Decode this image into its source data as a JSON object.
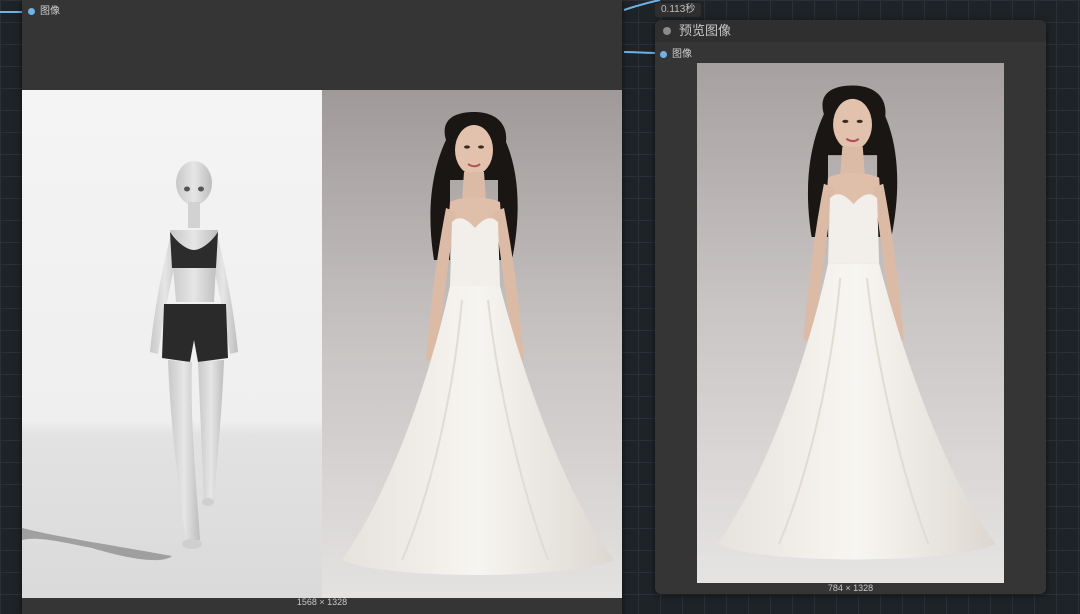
{
  "left_node": {
    "output_label": "图像",
    "dimensions": "1568 × 1328"
  },
  "right_node": {
    "title": "预览图像",
    "input_label": "图像",
    "dimensions": "784 × 1328"
  },
  "exec_time_badge": "0.113秒",
  "colors": {
    "canvas": "#1e2327",
    "node_body": "#353535",
    "wire": "#6fb3e6"
  }
}
